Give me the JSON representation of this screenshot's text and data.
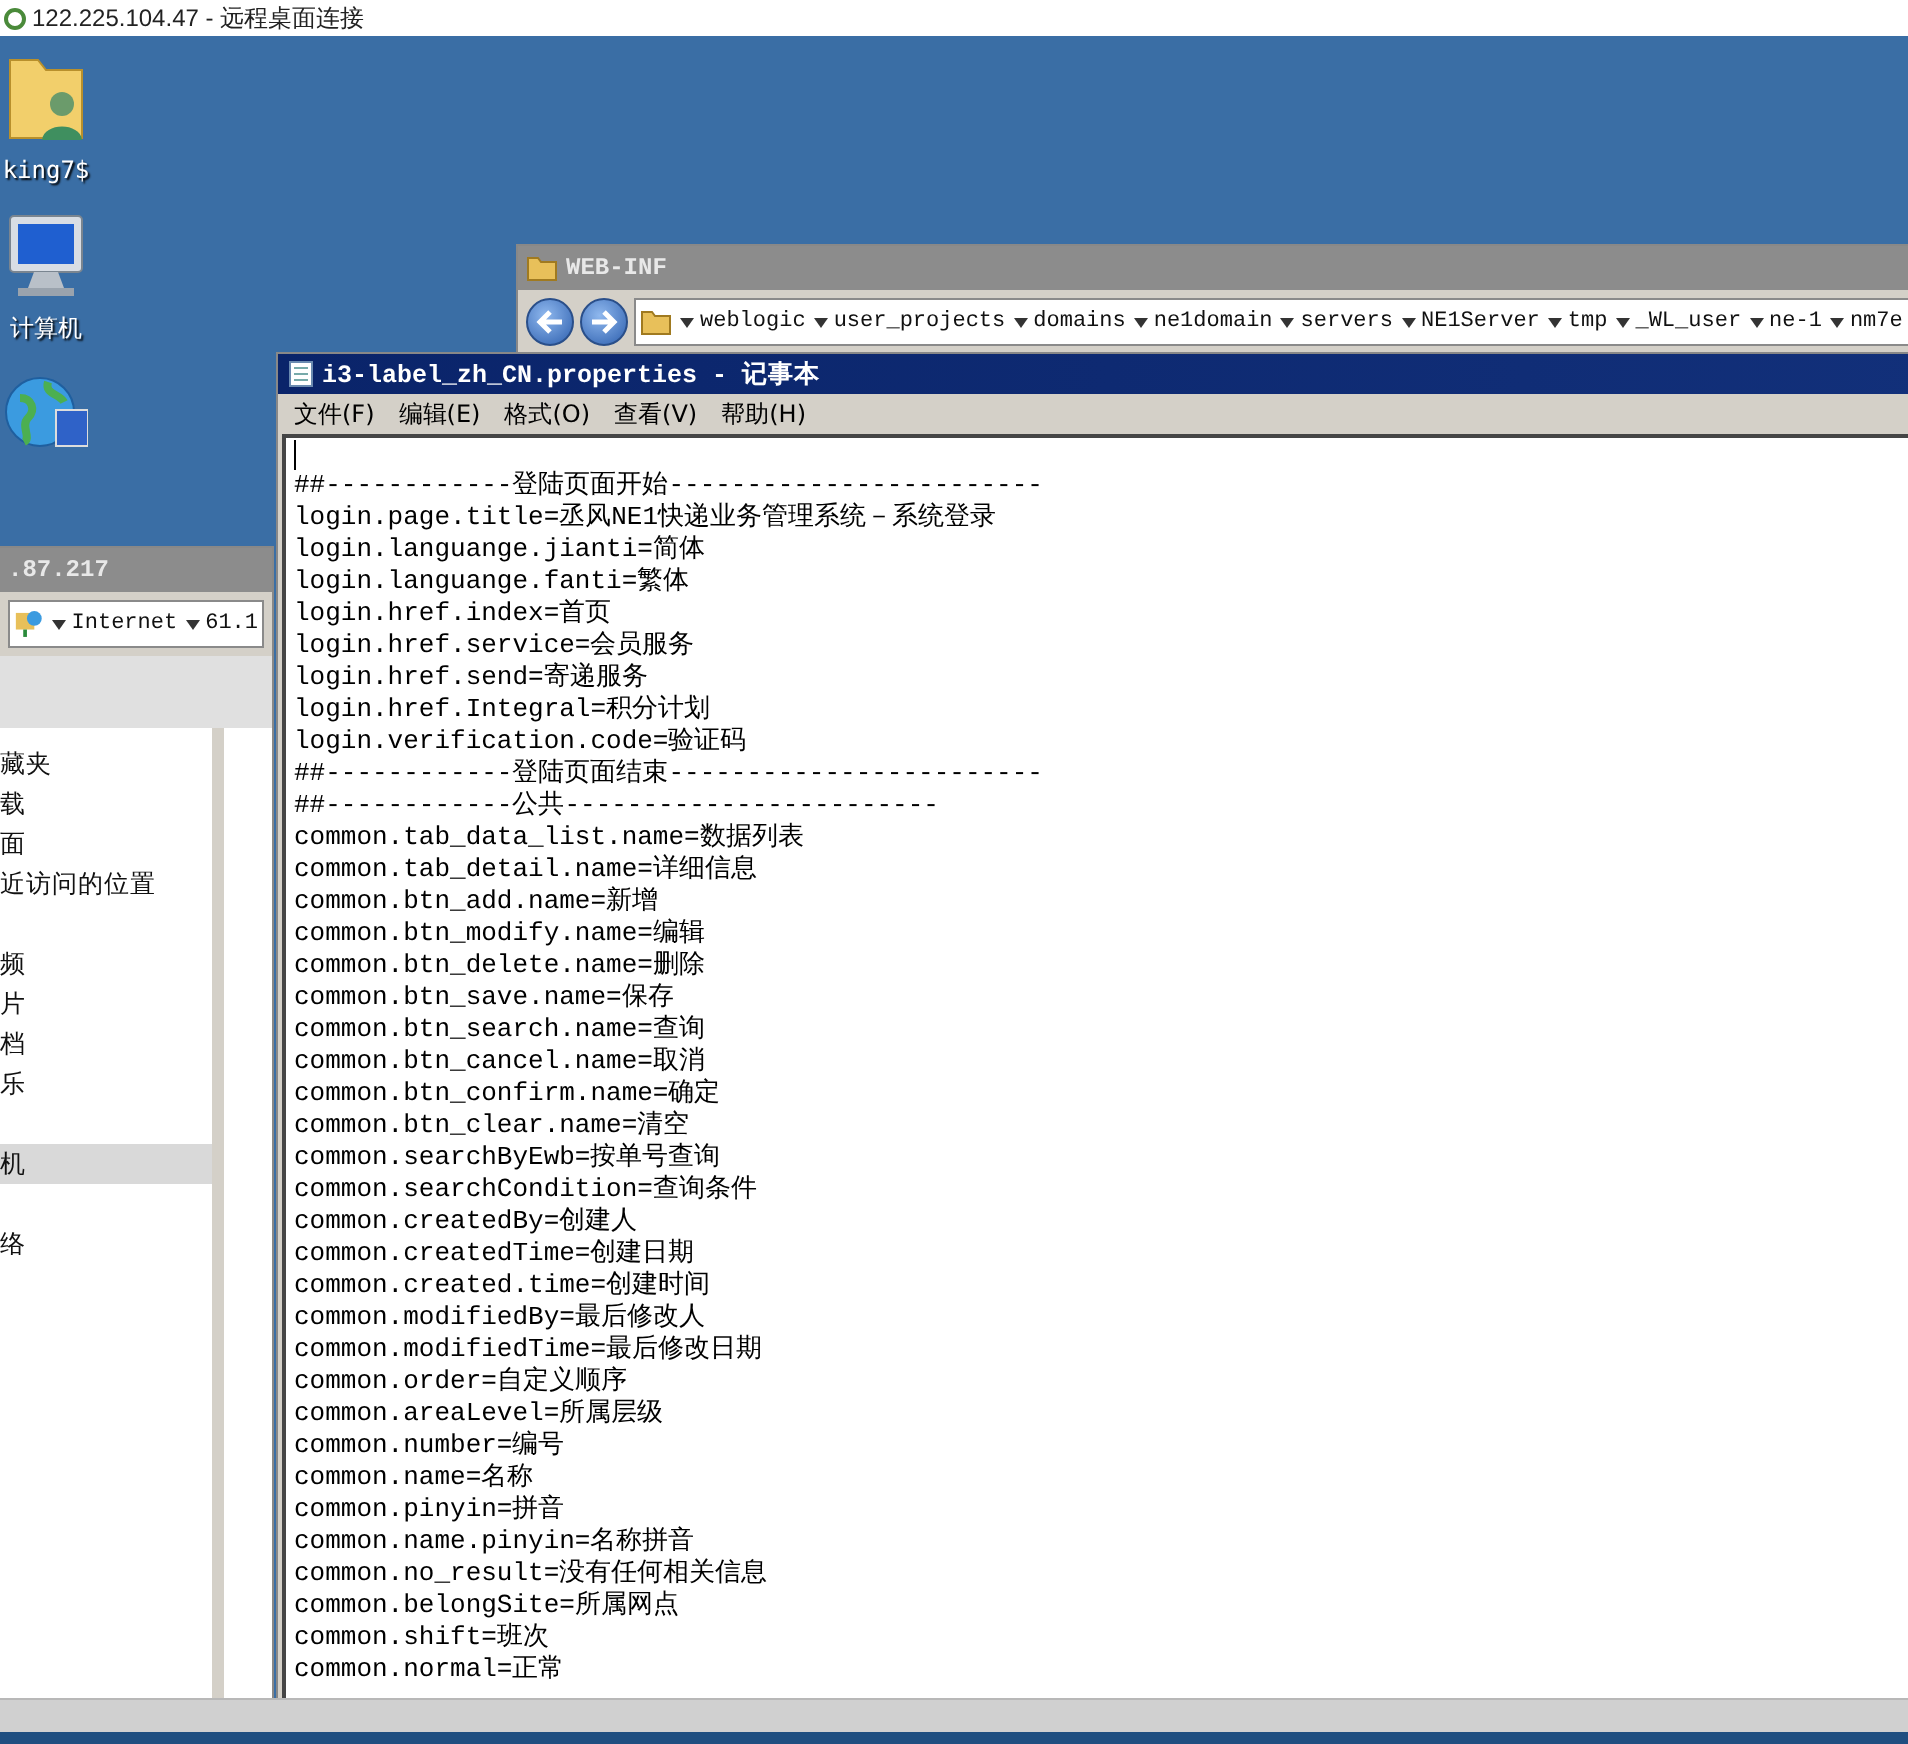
{
  "remote_desktop": {
    "title": "122.225.104.47 - 远程桌面连接"
  },
  "desktop_icons": [
    {
      "kind": "user-folder",
      "label": "king7$"
    },
    {
      "kind": "computer",
      "label": "计算机"
    },
    {
      "kind": "globe"
    }
  ],
  "explorer_web_inf": {
    "title": "WEB-INF",
    "breadcrumb": [
      "weblogic",
      "user_projects",
      "domains",
      "ne1domain",
      "servers",
      "NE1Server",
      "tmp",
      "_WL_user",
      "ne-1",
      "nm7e"
    ]
  },
  "explorer_left": {
    "title": ".87.217",
    "address": [
      "Internet",
      "61.1"
    ],
    "nav_groups": [
      [
        {
          "label": "藏夹",
          "selected": false
        },
        {
          "label": "载",
          "selected": false
        },
        {
          "label": "面",
          "selected": false
        },
        {
          "label": "近访问的位置",
          "selected": false
        }
      ],
      [
        {
          "label": "频",
          "selected": false
        },
        {
          "label": "片",
          "selected": false
        },
        {
          "label": "档",
          "selected": false
        },
        {
          "label": "乐",
          "selected": false
        }
      ],
      [
        {
          "label": "机",
          "selected": true
        }
      ],
      [
        {
          "label": "络",
          "selected": false
        }
      ]
    ]
  },
  "notepad": {
    "title": "i3-label_zh_CN.properties - 记事本",
    "menu": [
      "文件(F)",
      "编辑(E)",
      "格式(O)",
      "查看(V)",
      "帮助(H)"
    ],
    "lines": [
      "##------------登陆页面开始------------------------",
      "login.page.title=丞风NE1快递业务管理系统－系统登录",
      "login.languange.jianti=简体",
      "login.languange.fanti=繁体",
      "login.href.index=首页",
      "login.href.service=会员服务",
      "login.href.send=寄递服务",
      "login.href.Integral=积分计划",
      "login.verification.code=验证码",
      "##------------登陆页面结束------------------------",
      "##------------公共------------------------",
      "common.tab_data_list.name=数据列表",
      "common.tab_detail.name=详细信息",
      "common.btn_add.name=新增",
      "common.btn_modify.name=编辑",
      "common.btn_delete.name=删除",
      "common.btn_save.name=保存",
      "common.btn_search.name=查询",
      "common.btn_cancel.name=取消",
      "common.btn_confirm.name=确定",
      "common.btn_clear.name=清空",
      "common.searchByEwb=按单号查询",
      "common.searchCondition=查询条件",
      "common.createdBy=创建人",
      "common.createdTime=创建日期",
      "common.created.time=创建时间",
      "common.modifiedBy=最后修改人",
      "common.modifiedTime=最后修改日期",
      "common.order=自定义顺序",
      "common.areaLevel=所属层级",
      "common.number=编号",
      "common.name=名称",
      "common.pinyin=拼音",
      "common.name.pinyin=名称拼音",
      "common.no_result=没有任何相关信息",
      "common.belongSite=所属网点",
      "common.shift=班次",
      "common.normal=正常"
    ]
  }
}
